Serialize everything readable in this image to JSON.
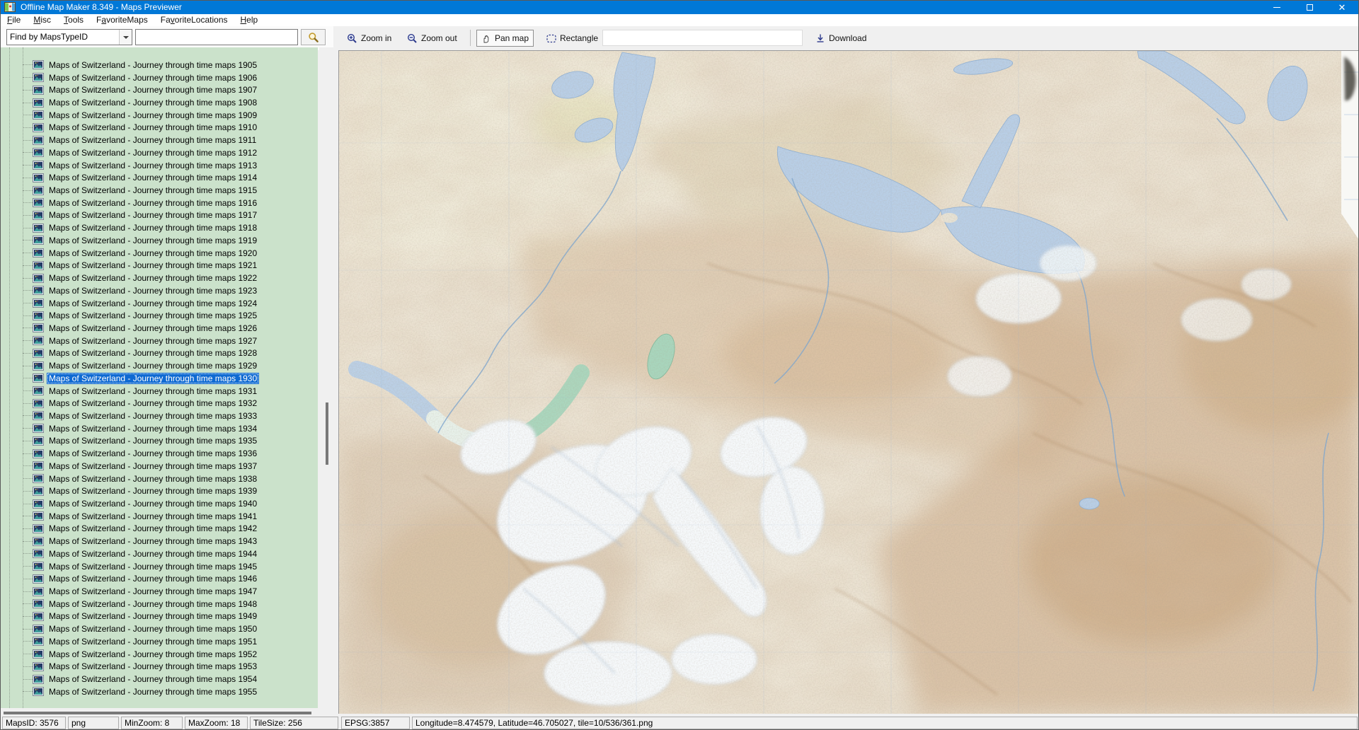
{
  "window": {
    "title": "Offline Map Maker 8.349 - Maps Previewer",
    "controls": [
      "minimize",
      "maximize",
      "close"
    ]
  },
  "menu": {
    "items": [
      {
        "label": "File",
        "accel": 0
      },
      {
        "label": "Misc",
        "accel": 0
      },
      {
        "label": "Tools",
        "accel": 0
      },
      {
        "label": "FavoriteMaps",
        "accel": 1
      },
      {
        "label": "FavoriteLocations",
        "accel": 2
      },
      {
        "label": "Help",
        "accel": 0
      }
    ]
  },
  "finder": {
    "dropdown_value": "Find by MapsTypeID",
    "search_value": "",
    "search_icon": "magnifier-icon"
  },
  "toolbar": {
    "zoom_in": "Zoom in",
    "zoom_out": "Zoom out",
    "pan_map": "Pan map",
    "rectangle": "Rectangle",
    "input_value": "",
    "download": "Download",
    "active_tool": "Pan map"
  },
  "tree": {
    "selected": "Maps of Switzerland - Journey through time maps 1930",
    "items": [
      "Maps of Switzerland - Journey through time maps 1905",
      "Maps of Switzerland - Journey through time maps 1906",
      "Maps of Switzerland - Journey through time maps 1907",
      "Maps of Switzerland - Journey through time maps 1908",
      "Maps of Switzerland - Journey through time maps 1909",
      "Maps of Switzerland - Journey through time maps 1910",
      "Maps of Switzerland - Journey through time maps 1911",
      "Maps of Switzerland - Journey through time maps 1912",
      "Maps of Switzerland - Journey through time maps 1913",
      "Maps of Switzerland - Journey through time maps 1914",
      "Maps of Switzerland - Journey through time maps 1915",
      "Maps of Switzerland - Journey through time maps 1916",
      "Maps of Switzerland - Journey through time maps 1917",
      "Maps of Switzerland - Journey through time maps 1918",
      "Maps of Switzerland - Journey through time maps 1919",
      "Maps of Switzerland - Journey through time maps 1920",
      "Maps of Switzerland - Journey through time maps 1921",
      "Maps of Switzerland - Journey through time maps 1922",
      "Maps of Switzerland - Journey through time maps 1923",
      "Maps of Switzerland - Journey through time maps 1924",
      "Maps of Switzerland - Journey through time maps 1925",
      "Maps of Switzerland - Journey through time maps 1926",
      "Maps of Switzerland - Journey through time maps 1927",
      "Maps of Switzerland - Journey through time maps 1928",
      "Maps of Switzerland - Journey through time maps 1929",
      "Maps of Switzerland - Journey through time maps 1930",
      "Maps of Switzerland - Journey through time maps 1931",
      "Maps of Switzerland - Journey through time maps 1932",
      "Maps of Switzerland - Journey through time maps 1933",
      "Maps of Switzerland - Journey through time maps 1934",
      "Maps of Switzerland - Journey through time maps 1935",
      "Maps of Switzerland - Journey through time maps 1936",
      "Maps of Switzerland - Journey through time maps 1937",
      "Maps of Switzerland - Journey through time maps 1938",
      "Maps of Switzerland - Journey through time maps 1939",
      "Maps of Switzerland - Journey through time maps 1940",
      "Maps of Switzerland - Journey through time maps 1941",
      "Maps of Switzerland - Journey through time maps 1942",
      "Maps of Switzerland - Journey through time maps 1943",
      "Maps of Switzerland - Journey through time maps 1944",
      "Maps of Switzerland - Journey through time maps 1945",
      "Maps of Switzerland - Journey through time maps 1946",
      "Maps of Switzerland - Journey through time maps 1947",
      "Maps of Switzerland - Journey through time maps 1948",
      "Maps of Switzerland - Journey through time maps 1949",
      "Maps of Switzerland - Journey through time maps 1950",
      "Maps of Switzerland - Journey through time maps 1951",
      "Maps of Switzerland - Journey through time maps 1952",
      "Maps of Switzerland - Journey through time maps 1953",
      "Maps of Switzerland - Journey through time maps 1954",
      "Maps of Switzerland - Journey through time maps 1955"
    ]
  },
  "status_bar": {
    "panels": [
      "MapsID: 3576",
      "png",
      "MinZoom: 8",
      "MaxZoom: 18",
      "TileSize: 256",
      "EPSG:3857",
      "Longitude=8.474579, Latitude=46.705027, tile=10/536/361.png"
    ]
  },
  "colors": {
    "titlebar": "#0078d7",
    "selection": "#0f6ad2",
    "tree_background": "#cbe2cb",
    "toolbar_background": "#f0f0f0",
    "lake_blue": "#b9cfe7",
    "lake_green": "#a8d6bd",
    "glacier_white": "#f6f9fb",
    "terrain_tan": "#d9c0a0"
  }
}
